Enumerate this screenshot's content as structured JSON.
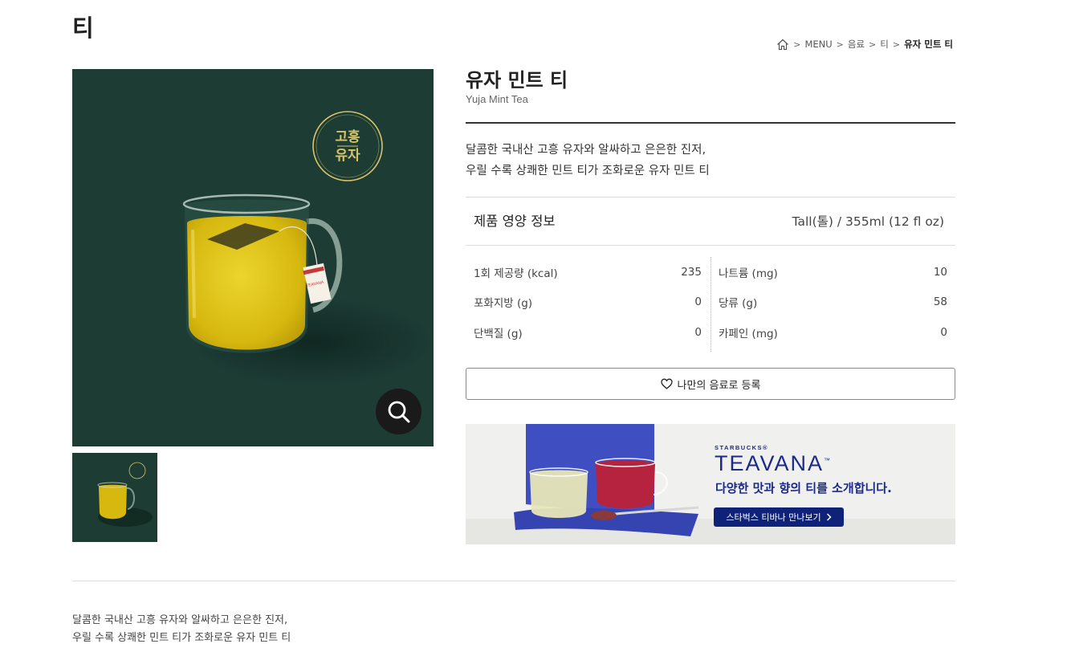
{
  "page": {
    "title": "티"
  },
  "breadcrumb": {
    "items": [
      "MENU",
      "음료",
      "티"
    ],
    "current": "유자 민트 티",
    "home_icon": "home-icon",
    "separator_icon": "chevron-right-icon"
  },
  "product": {
    "name_ko": "유자 민트 티",
    "name_en": "Yuja Mint Tea",
    "description_lines": [
      "달콤한 국내산 고흥 유자와 알싸하고 은은한 진저,",
      "우릴 수록 상쾌한 민트 티가 조화로운 유자 민트 티"
    ],
    "badge_lines": [
      "고흥",
      "유자"
    ],
    "tea_tag_text": "TEAVANA",
    "zoom_icon": "search-icon"
  },
  "nutrition": {
    "title": "제품 영양 정보",
    "serving_size": "Tall(톨) / 355ml (12 fl oz)",
    "left": [
      {
        "label": "1회 제공량 (kcal)",
        "value": "235"
      },
      {
        "label": "포화지방 (g)",
        "value": "0"
      },
      {
        "label": "단백질 (g)",
        "value": "0"
      }
    ],
    "right": [
      {
        "label": "나트륨 (mg)",
        "value": "10"
      },
      {
        "label": "당류 (g)",
        "value": "58"
      },
      {
        "label": "카페인 (mg)",
        "value": "0"
      }
    ]
  },
  "favorite": {
    "label": "나만의 음료로 등록",
    "icon": "heart-icon"
  },
  "banner": {
    "brand": "STARBUCKS®",
    "name": "TEAVANA",
    "trademark": "™",
    "tagline": "다양한 맛과 향의 티를 소개합니다.",
    "cta_label": "스타벅스 티바나 만나보기",
    "cta_icon": "chevron-right-icon"
  },
  "bottom": {
    "description_lines": [
      "달콤한 국내산 고흥 유자와 알싸하고 은은한 진저,",
      "우릴 수록 상쾌한 민트 티가 조화로운 유자 민트 티"
    ]
  },
  "colors": {
    "photo_background": "#1c3c34",
    "tea_yellow": "#d6b80f",
    "badge_gold": "#d8c46a",
    "brand_navy": "#1b2a8a",
    "cta_navy": "#0f2279"
  }
}
